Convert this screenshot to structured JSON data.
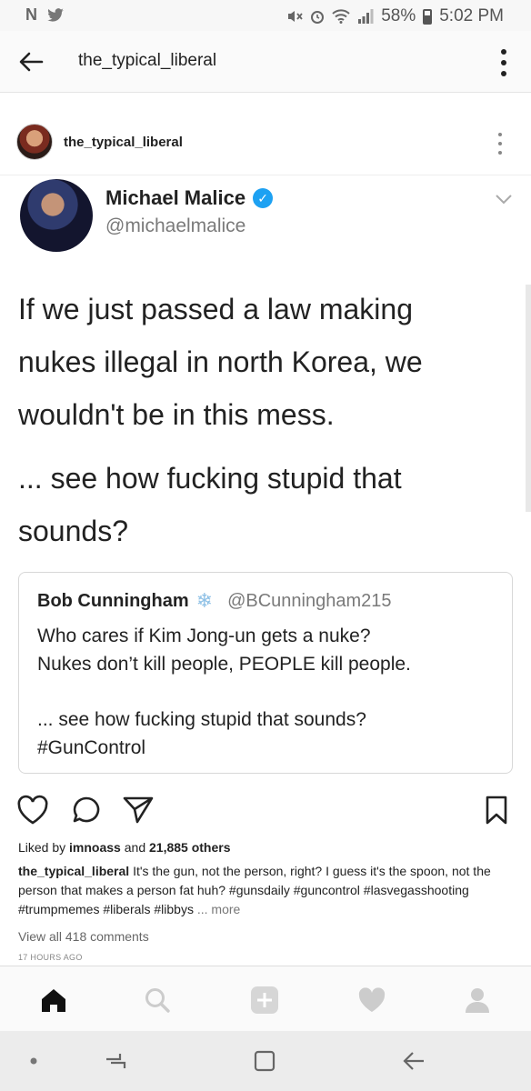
{
  "status_bar": {
    "left_icons": [
      "N",
      "twitter-bird-icon"
    ],
    "battery": "58%",
    "time": "5:02 PM"
  },
  "header": {
    "title": "the_typical_liberal"
  },
  "post": {
    "username": "the_typical_liberal"
  },
  "tweet": {
    "name": "Michael Malice",
    "handle": "@michaelmalice",
    "text_1": "If we just passed a law making nukes illegal in north Korea, we wouldn't be in this mess.",
    "text_2": "... see how fucking stupid that sounds?",
    "quote": {
      "name": "Bob Cunningham",
      "handle": "@BCunningham215",
      "line_1": "Who cares if Kim Jong-un gets a nuke?",
      "line_2": "Nukes don’t kill people, PEOPLE kill people.",
      "line_3": "... see how fucking stupid that sounds?",
      "line_4": "#GunControl"
    }
  },
  "likes": {
    "prefix": "Liked by",
    "user": "imnoass",
    "middle": "and",
    "count": "21,885 others"
  },
  "caption": {
    "username": "the_typical_liberal",
    "text": "It's the gun, not the person, right? I guess it's the spoon, not the person that makes a person fat huh? #gunsdaily #guncontrol #lasvegasshooting #trumpmemes #liberals #libbys",
    "more": "... more"
  },
  "comments_link": "View all 418 comments",
  "time_ago": "17 HOURS AGO",
  "colors": {
    "verified": "#1da1f2",
    "text": "#222222",
    "muted": "#7a7a7a"
  }
}
